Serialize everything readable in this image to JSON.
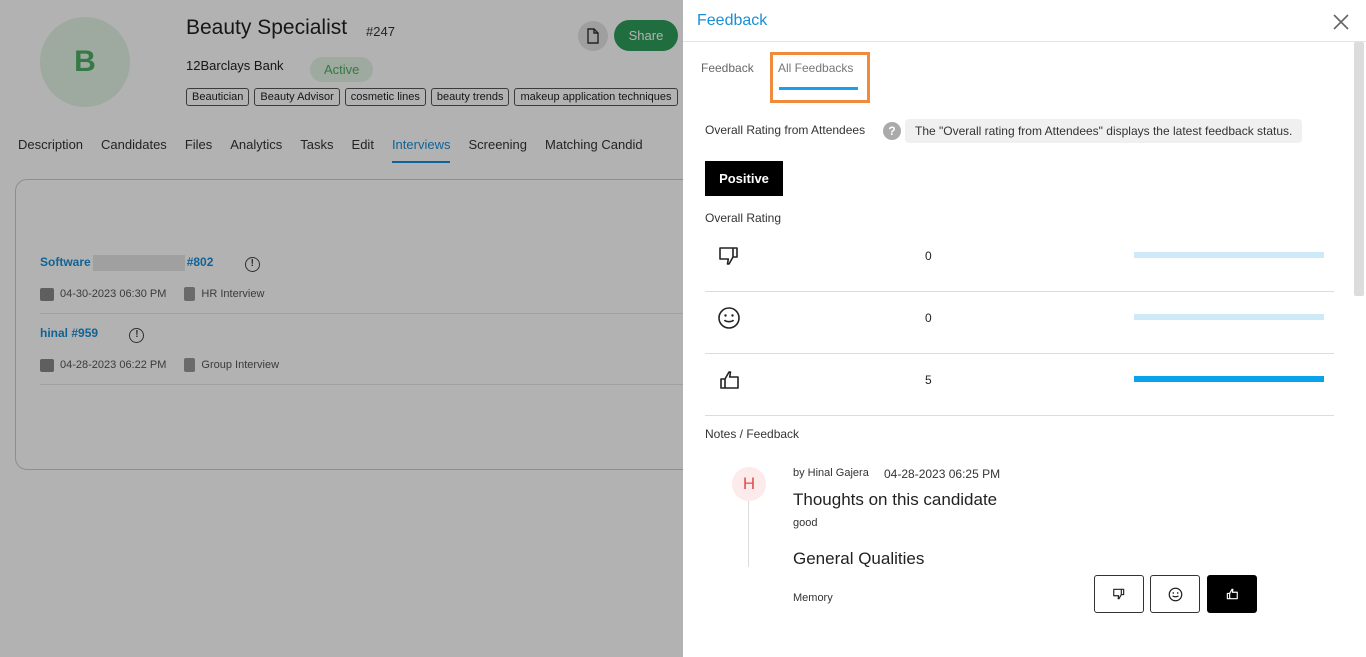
{
  "job": {
    "avatar_letter": "B",
    "title": "Beauty Specialist",
    "id": "#247",
    "company": "12Barclays Bank",
    "status": "Active",
    "tags": [
      "Beautician",
      "Beauty Advisor",
      "cosmetic lines",
      "beauty trends",
      "makeup application techniques"
    ],
    "share_label": "Share"
  },
  "nav": {
    "items": [
      "Description",
      "Candidates",
      "Files",
      "Analytics",
      "Tasks",
      "Edit",
      "Interviews",
      "Screening",
      "Matching Candid"
    ],
    "active": "Interviews"
  },
  "interviews": [
    {
      "name": "Software",
      "id": "#802",
      "datetime": "04-30-2023 06:30 PM",
      "type": "HR Interview"
    },
    {
      "name": "hinal",
      "id": "#959",
      "datetime": "04-28-2023 06:22 PM",
      "type": "Group Interview"
    }
  ],
  "drawer": {
    "title": "Feedback",
    "tabs": [
      "Feedback",
      "All Feedbacks"
    ],
    "active_tab": "All Feedbacks",
    "overall_from_attendees_label": "Overall Rating from Attendees",
    "tooltip": "The \"Overall rating from Attendees\" displays the latest feedback status.",
    "overall_status": "Positive",
    "overall_rating_label": "Overall Rating",
    "ratings": [
      {
        "icon": "thumbs-down-icon",
        "count": "0",
        "fill_fraction": 0
      },
      {
        "icon": "smiley-icon",
        "count": "0",
        "fill_fraction": 0
      },
      {
        "icon": "thumbs-up-icon",
        "count": "5",
        "fill_fraction": 1
      }
    ],
    "notes_label": "Notes / Feedback",
    "note": {
      "avatar_letter": "H",
      "by": "by Hinal Gajera",
      "date": "04-28-2023 06:25 PM",
      "heading": "Thoughts on this candidate",
      "body": "good",
      "qualities_heading": "General Qualities",
      "quality_item": "Memory",
      "selected_rating": "thumbs-up"
    }
  },
  "colors": {
    "accent": "#1a8fd6",
    "share": "#2f9e5b",
    "status_green": "#4cae62",
    "highlight": "#f08a3c",
    "bar_fill": "#08a3ea",
    "bar_track": "#cdeaf6"
  }
}
